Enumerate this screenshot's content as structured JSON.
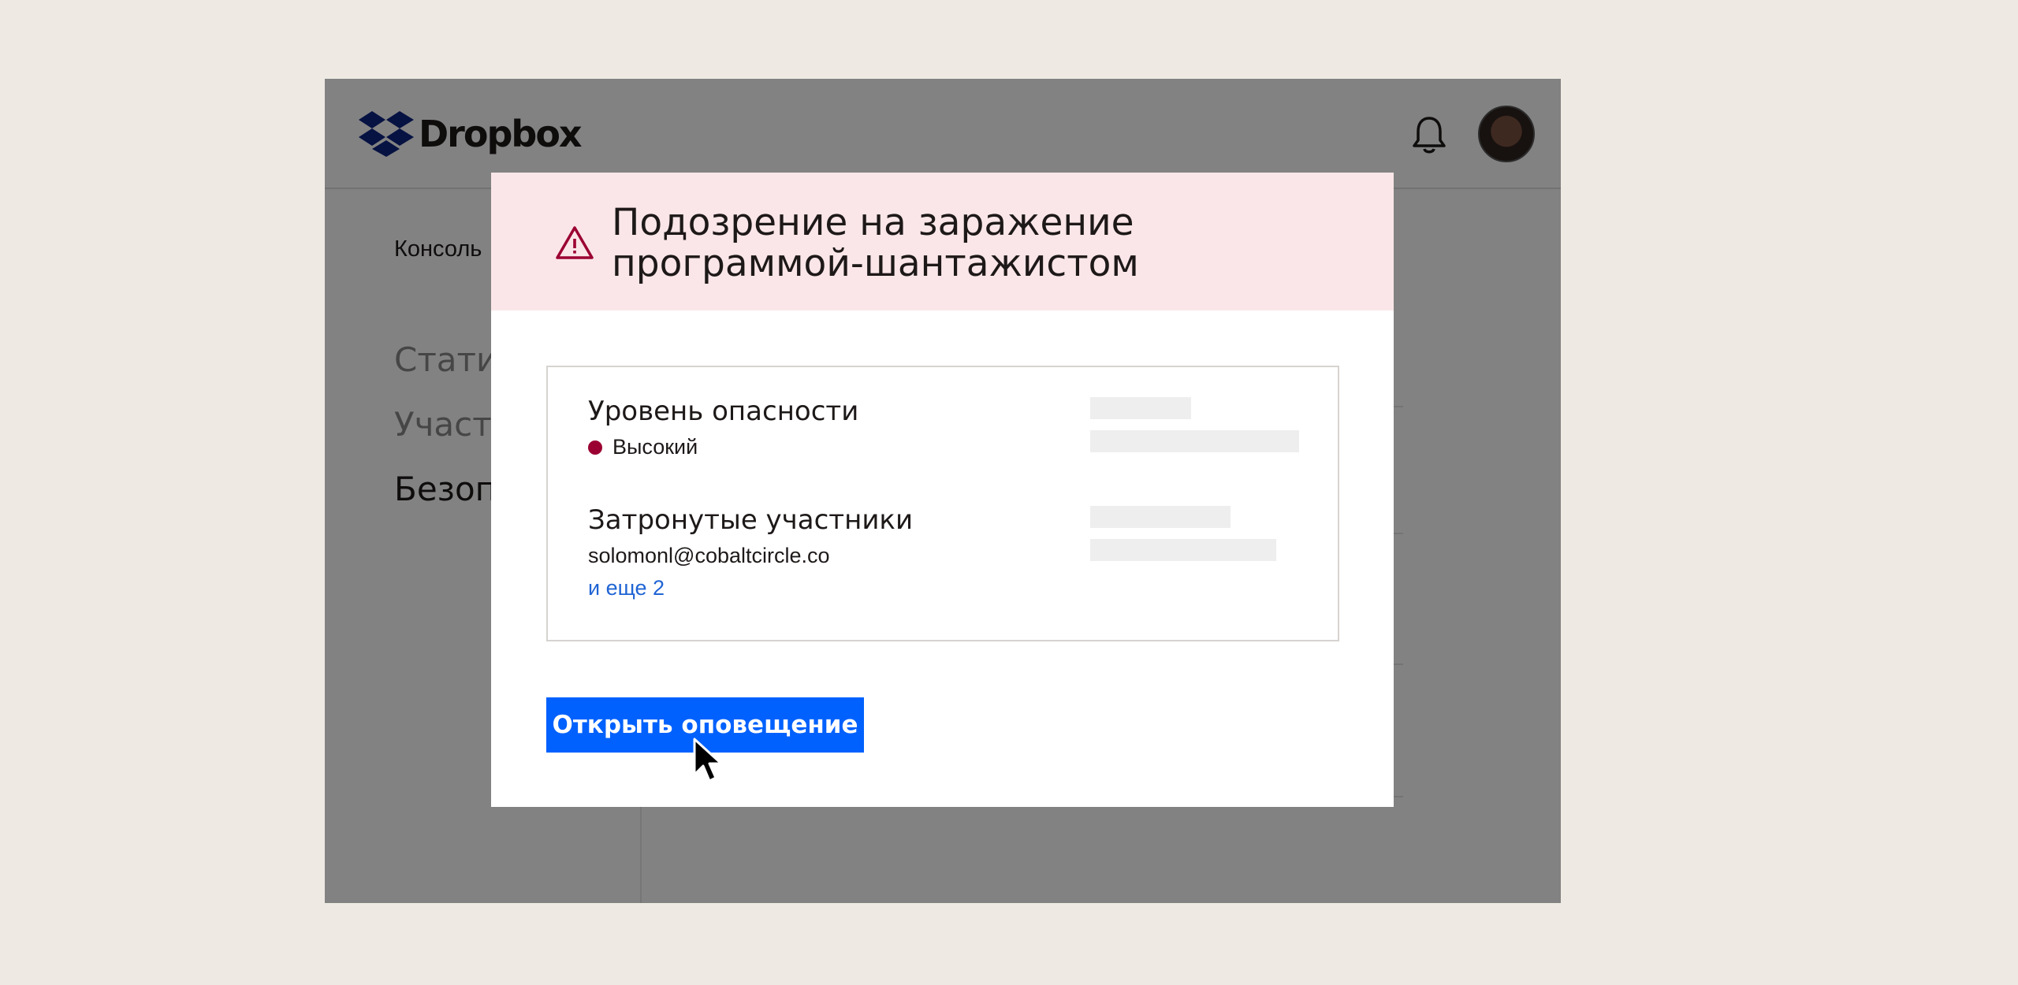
{
  "app": {
    "brand_name": "Dropbox",
    "console_label": "Консоль",
    "nav_items": [
      "Стати",
      "Участ",
      "Безоп"
    ],
    "active_nav_index": 2
  },
  "alert": {
    "title": "Подозрение на заражение программой-шантажистом",
    "severity_label": "Уровень опасности",
    "severity_value": "Высокий",
    "members_label": "Затронутые участники",
    "member_email": "solomonl@cobaltcircle.co",
    "more_members_link": "и еще 2",
    "open_button_label": "Открыть оповещение"
  },
  "colors": {
    "accent": "#0061FE",
    "header_bg": "#FAE6E8",
    "severity_high": "#9B0032",
    "link": "#1F64D4",
    "page_bg": "#EEE9E3"
  },
  "icons": {
    "logo": "dropbox-logo-icon",
    "bell": "bell-icon",
    "warning": "warning-triangle-icon",
    "cursor": "mouse-pointer-icon"
  }
}
